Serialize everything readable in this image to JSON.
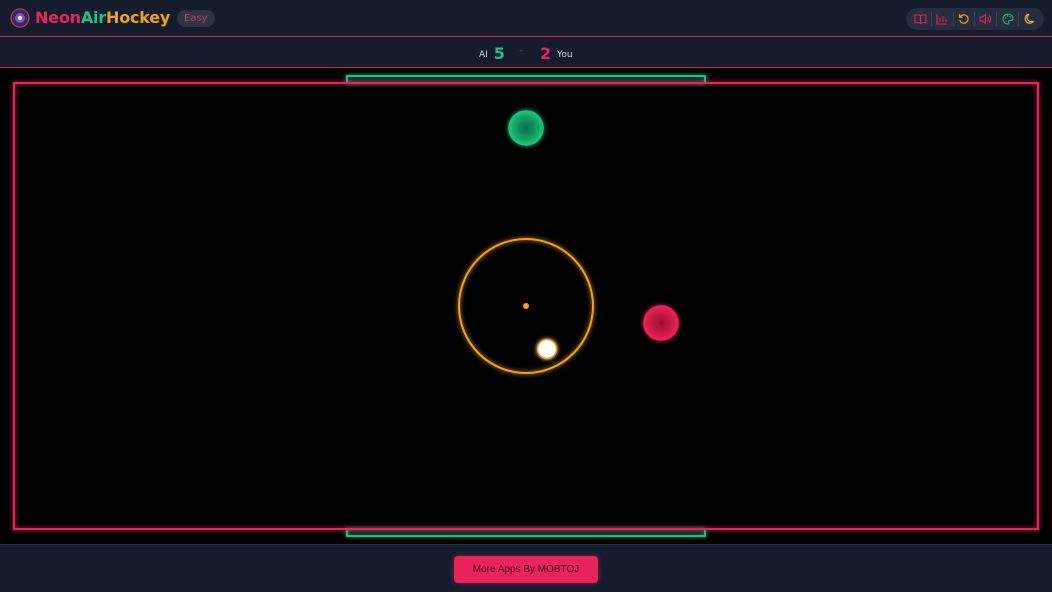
{
  "header": {
    "title_parts": [
      "Neon",
      "Air",
      "Hockey"
    ],
    "difficulty": "Easy",
    "toolbar": [
      {
        "icon": "book-icon"
      },
      {
        "icon": "bar-chart-icon"
      },
      {
        "icon": "restart-icon"
      },
      {
        "icon": "volume-icon"
      },
      {
        "icon": "palette-icon"
      },
      {
        "icon": "moon-icon"
      }
    ]
  },
  "score": {
    "ai_label": "AI",
    "ai_score": "5",
    "separator": "–",
    "player_score": "2",
    "player_label": "You"
  },
  "colors": {
    "pink": "#e8245a",
    "green": "#1fc27e",
    "orange": "#f0a020",
    "puck": "#ffffff"
  },
  "footer": {
    "button_label": "More Apps By MOBTOJ"
  }
}
